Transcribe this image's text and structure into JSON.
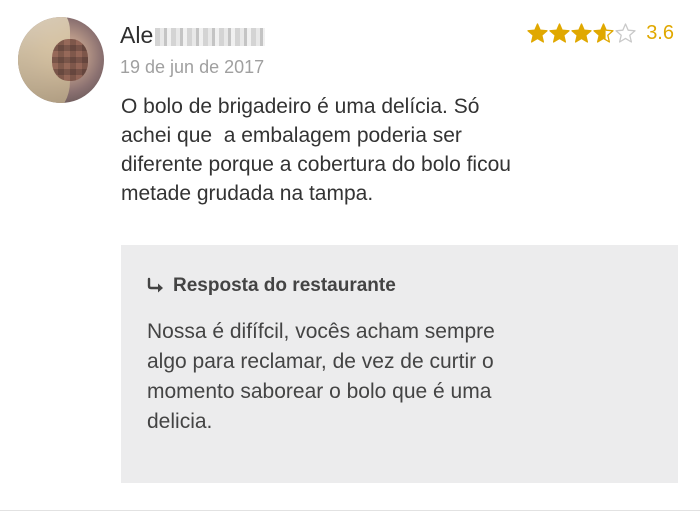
{
  "review": {
    "author_name_visible": "Ale",
    "date": "19 de jun de 2017",
    "rating": {
      "value_label": "3.6",
      "value": 3.6,
      "max": 5,
      "star_color": "#e0a800",
      "empty_star_color": "#c9c9c9"
    },
    "comment": "O bolo de brigadeiro é uma delícia. Só\nachei que  a embalagem poderia ser\ndiferente porque a cobertura do bolo ficou\nmetade grudada na tampa."
  },
  "reply": {
    "header_label": "Resposta do restaurante",
    "text": "Nossa é difífcil, vocês acham sempre\nalgo para reclamar, de vez de curtir o\nmomento saborear o bolo que é uma\ndelicia."
  },
  "icons": {
    "reply_arrow": "reply-arrow-icon",
    "star": "star-icon"
  }
}
